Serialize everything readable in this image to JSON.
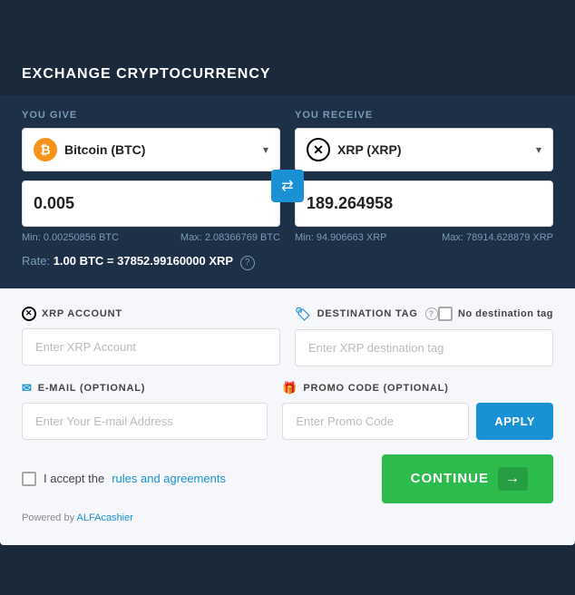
{
  "header": {
    "title": "EXCHANGE CRYPTOCURRENCY"
  },
  "you_give": {
    "label": "YOU GIVE",
    "currency_name": "Bitcoin (BTC)",
    "currency_icon": "₿",
    "amount": "0.005",
    "min_label": "Min: 0.00250856 BTC",
    "max_label": "Max: 2.08366769 BTC"
  },
  "you_receive": {
    "label": "YOU RECEIVE",
    "currency_name": "XRP (XRP)",
    "currency_icon": "✕",
    "amount": "189.264958",
    "min_label": "Min: 94.906663 XRP",
    "max_label": "Max: 78914.628879 XRP"
  },
  "rate": {
    "prefix": "Rate: ",
    "value": "1.00 BTC = 37852.99160000 XRP"
  },
  "xrp_account": {
    "label": "XRP ACCOUNT",
    "placeholder": "Enter XRP Account"
  },
  "destination_tag": {
    "label": "DESTINATION TAG",
    "placeholder": "Enter XRP destination tag",
    "no_dest_label": "No destination tag"
  },
  "email": {
    "label": "E-MAIL (OPTIONAL)",
    "placeholder": "Enter Your E-mail Address"
  },
  "promo": {
    "label": "PROMO CODE (OPTIONAL)",
    "placeholder": "Enter Promo Code",
    "apply_label": "APPLY"
  },
  "accept": {
    "text": "I accept the ",
    "link_text": "rules and agreements"
  },
  "continue_btn": {
    "label": "CONTINUE"
  },
  "powered_by": {
    "text": "Powered by ",
    "link_text": "ALFAcashier"
  }
}
